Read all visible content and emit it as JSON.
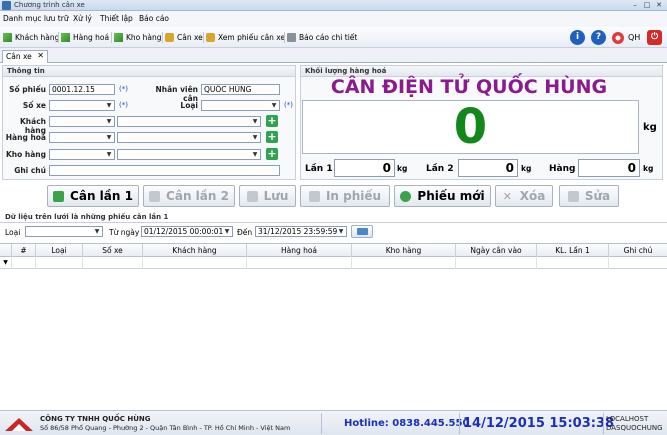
{
  "window": {
    "title": "Chương trình cân xe"
  },
  "menu": [
    "Danh mục lưu trữ",
    "Xử lý",
    "Thiết lập",
    "Báo cáo"
  ],
  "toolbar": {
    "items": [
      "Khách hàng",
      "Hàng hoá",
      "Kho hàng",
      "Cân xe",
      "Xem phiếu cân xe",
      "Báo cáo chi tiết"
    ],
    "user_label": "QH"
  },
  "tab": {
    "label": "Cân xe"
  },
  "info": {
    "heading": "Thông tin",
    "so_phieu_label": "Số phiếu",
    "so_phieu_value": "0001.12.15",
    "required_mark": "(*)",
    "nhan_vien_label": "Nhân viên cân",
    "nhan_vien_value": "QUỐC HÙNG",
    "so_xe_label": "Số xe",
    "loai_label": "Loại",
    "khach_hang_label": "Khách hàng",
    "hang_hoa_label": "Hàng hoá",
    "kho_hang_label": "Kho hàng",
    "ghi_chu_label": "Ghi chú"
  },
  "weight": {
    "heading": "Khối lượng hàng hoá",
    "company": "CÂN ĐIỆN TỬ QUỐC HÙNG",
    "value": "0",
    "unit": "kg",
    "lan1_label": "Lần 1",
    "lan1_value": "0",
    "lan2_label": "Lần 2",
    "lan2_value": "0",
    "hang_label": "Hàng",
    "hang_value": "0"
  },
  "actions": {
    "can_lan_1": "Cân lần 1",
    "can_lan_2": "Cân lần 2",
    "luu": "Lưu",
    "in_phieu": "In phiếu",
    "phieu_moi": "Phiếu mới",
    "xoa": "Xóa",
    "sua": "Sửa"
  },
  "grid": {
    "caption": "Dữ liệu trên lưới là những phiếu cân lần 1",
    "filter_loai_label": "Loại",
    "tu_ngay_label": "Từ ngày",
    "tu_ngay_value": "01/12/2015 00:00:01",
    "den_label": "Đến",
    "den_value": "31/12/2015 23:59:59",
    "columns": [
      "#",
      "Loại",
      "Số xe",
      "Khách hàng",
      "Hàng hoá",
      "Kho hàng",
      "Ngày cân vào",
      "KL. Lần 1",
      "Ghi chú"
    ]
  },
  "status": {
    "company_name": "CÔNG TY TNHH QUỐC HÙNG",
    "address": "Số 86/58 Phổ Quang - Phường 2 - Quận Tân Bình - TP. Hồ Chí Minh - Việt Nam",
    "hotline": "Hotline: 0838.445.550",
    "datetime": "14/12/2015 15:03:38",
    "server": "LOCALHOST",
    "user": "DASQUOCHUNG"
  },
  "colors": {
    "company_title": "#8a1a8e",
    "weight_value": "#12871a",
    "hotline": "#1b2fb8",
    "datetime": "#1b2fb8",
    "required_mark": "#1f3fd8"
  }
}
